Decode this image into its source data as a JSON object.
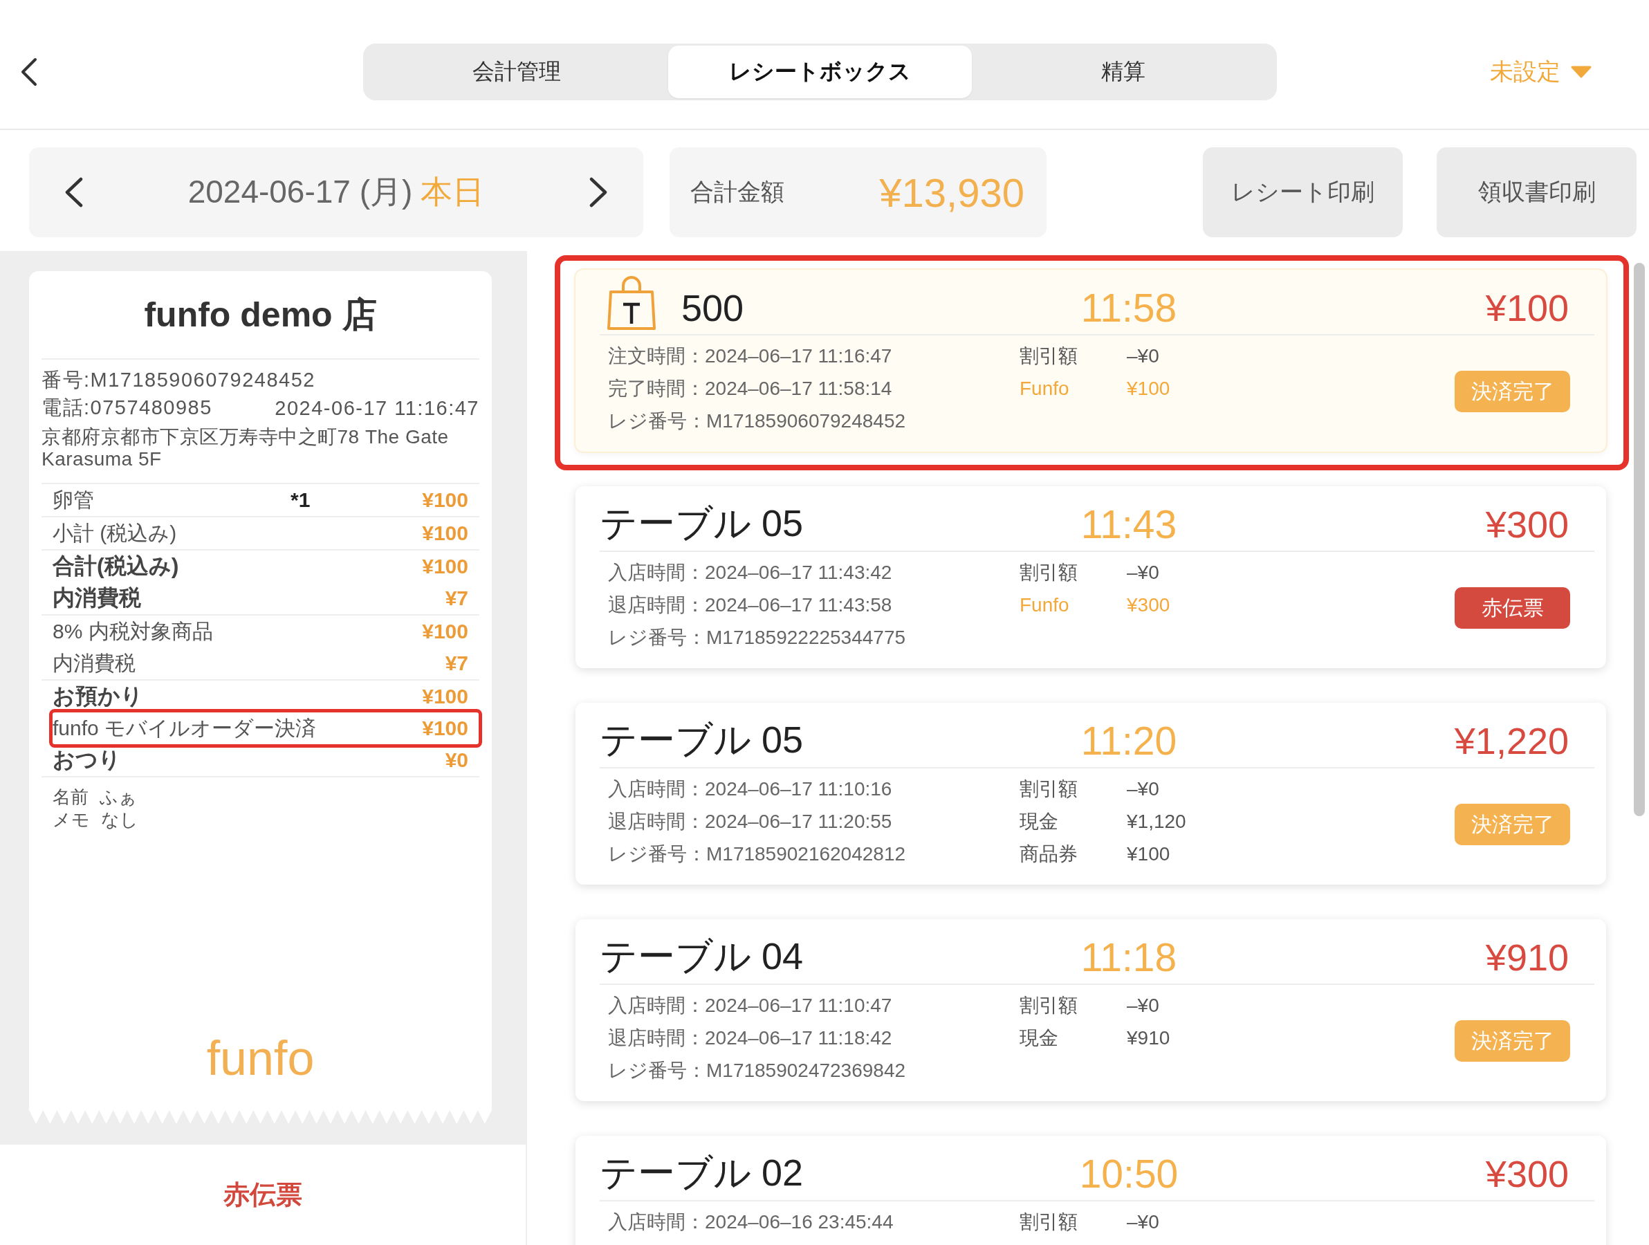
{
  "header": {
    "tabs": [
      {
        "label": "会計管理",
        "selected": false
      },
      {
        "label": "レシートボックス",
        "selected": true
      },
      {
        "label": "精算",
        "selected": false
      }
    ],
    "printer": "未設定"
  },
  "toolbar": {
    "date": "2024-06-17 (月)",
    "today": "本日",
    "total_label": "合計金額",
    "total_value": "¥13,930",
    "buttons": [
      "レシート印刷",
      "領収書印刷"
    ]
  },
  "receipt": {
    "store": "funfo demo 店",
    "number": "番号:M17185906079248452",
    "phone": "電話:0757480985",
    "datetime": "2024-06-17 11:16:47",
    "address": "京都府京都市下京区万寿寺中之町78 The Gate Karasuma 5F",
    "sections": [
      {
        "rows": [
          {
            "kind": "item",
            "label": "卵管",
            "qty": "*1",
            "value": "¥100",
            "emphasis": false,
            "highlighted": false
          }
        ]
      },
      {
        "rows": [
          {
            "kind": "line",
            "label": "小計 (税込み)",
            "value": "¥100",
            "emphasis": false,
            "highlighted": false
          }
        ]
      },
      {
        "rows": [
          {
            "kind": "line",
            "label": "合計(税込み)",
            "value": "¥100",
            "emphasis": true,
            "highlighted": false
          },
          {
            "kind": "line",
            "label": "内消費税",
            "value": "¥7",
            "emphasis": true,
            "highlighted": false
          }
        ]
      },
      {
        "rows": [
          {
            "kind": "line",
            "label": "8% 内税対象商品",
            "value": "¥100",
            "emphasis": false,
            "highlighted": false
          },
          {
            "kind": "line",
            "label": "内消費税",
            "value": "¥7",
            "emphasis": false,
            "highlighted": false
          }
        ]
      },
      {
        "rows": [
          {
            "kind": "line",
            "label": "お預かり",
            "value": "¥100",
            "emphasis": true,
            "highlighted": false
          },
          {
            "kind": "line",
            "label": "funfo モバイルオーダー決済",
            "value": "¥100",
            "emphasis": false,
            "highlighted": true
          },
          {
            "kind": "line",
            "label": "おつり",
            "value": "¥0",
            "emphasis": true,
            "highlighted": false
          }
        ]
      }
    ],
    "notes": [
      {
        "label": "名前",
        "value": "ふぁ"
      },
      {
        "label": "メモ",
        "value": "なし"
      }
    ],
    "logo": "funfo"
  },
  "void_button": "赤伝票",
  "orders": [
    {
      "kind": "takeout",
      "title": "500",
      "time": "11:58",
      "amount": "¥100",
      "selected": true,
      "highlighted": true,
      "details": [
        {
          "label": "注文時間：",
          "value": "2024–06–17 11:16:47"
        },
        {
          "label": "完了時間：",
          "value": "2024–06–17 11:58:14"
        },
        {
          "label": "レジ番号：",
          "value": "M17185906079248452"
        }
      ],
      "payments": [
        {
          "kind": "plain",
          "label": "割引額",
          "value": "–¥0"
        },
        {
          "kind": "funfo",
          "label": "Funfo",
          "value": "¥100"
        }
      ],
      "status": {
        "kind": "paid",
        "label": "決済完了"
      }
    },
    {
      "kind": "table",
      "title": "テーブル 05",
      "time": "11:43",
      "amount": "¥300",
      "selected": false,
      "highlighted": false,
      "details": [
        {
          "label": "入店時間：",
          "value": "2024–06–17 11:43:42"
        },
        {
          "label": "退店時間：",
          "value": "2024–06–17 11:43:58"
        },
        {
          "label": "レジ番号：",
          "value": "M17185922225344775"
        }
      ],
      "payments": [
        {
          "kind": "plain",
          "label": "割引額",
          "value": "–¥0"
        },
        {
          "kind": "funfo",
          "label": "Funfo",
          "value": "¥300"
        }
      ],
      "status": {
        "kind": "void",
        "label": "赤伝票"
      }
    },
    {
      "kind": "table",
      "title": "テーブル 05",
      "time": "11:20",
      "amount": "¥1,220",
      "selected": false,
      "highlighted": false,
      "details": [
        {
          "label": "入店時間：",
          "value": "2024–06–17 11:10:16"
        },
        {
          "label": "退店時間：",
          "value": "2024–06–17 11:20:55"
        },
        {
          "label": "レジ番号：",
          "value": "M17185902162042812"
        }
      ],
      "payments": [
        {
          "kind": "plain",
          "label": "割引額",
          "value": "–¥0"
        },
        {
          "kind": "plain",
          "label": "現金",
          "value": "¥1,120"
        },
        {
          "kind": "plain",
          "label": "商品券",
          "value": "¥100"
        }
      ],
      "status": {
        "kind": "paid",
        "label": "決済完了"
      }
    },
    {
      "kind": "table",
      "title": "テーブル 04",
      "time": "11:18",
      "amount": "¥910",
      "selected": false,
      "highlighted": false,
      "details": [
        {
          "label": "入店時間：",
          "value": "2024–06–17 11:10:47"
        },
        {
          "label": "退店時間：",
          "value": "2024–06–17 11:18:42"
        },
        {
          "label": "レジ番号：",
          "value": "M17185902472369842"
        }
      ],
      "payments": [
        {
          "kind": "plain",
          "label": "割引額",
          "value": "–¥0"
        },
        {
          "kind": "plain",
          "label": "現金",
          "value": "¥910"
        }
      ],
      "status": {
        "kind": "paid",
        "label": "決済完了"
      }
    },
    {
      "kind": "table",
      "title": "テーブル 02",
      "time": "10:50",
      "amount": "¥300",
      "selected": false,
      "highlighted": false,
      "details": [
        {
          "label": "入店時間：",
          "value": "2024–06–16 23:45:44"
        }
      ],
      "payments": [
        {
          "kind": "plain",
          "label": "割引額",
          "value": "–¥0"
        }
      ]
    }
  ]
}
